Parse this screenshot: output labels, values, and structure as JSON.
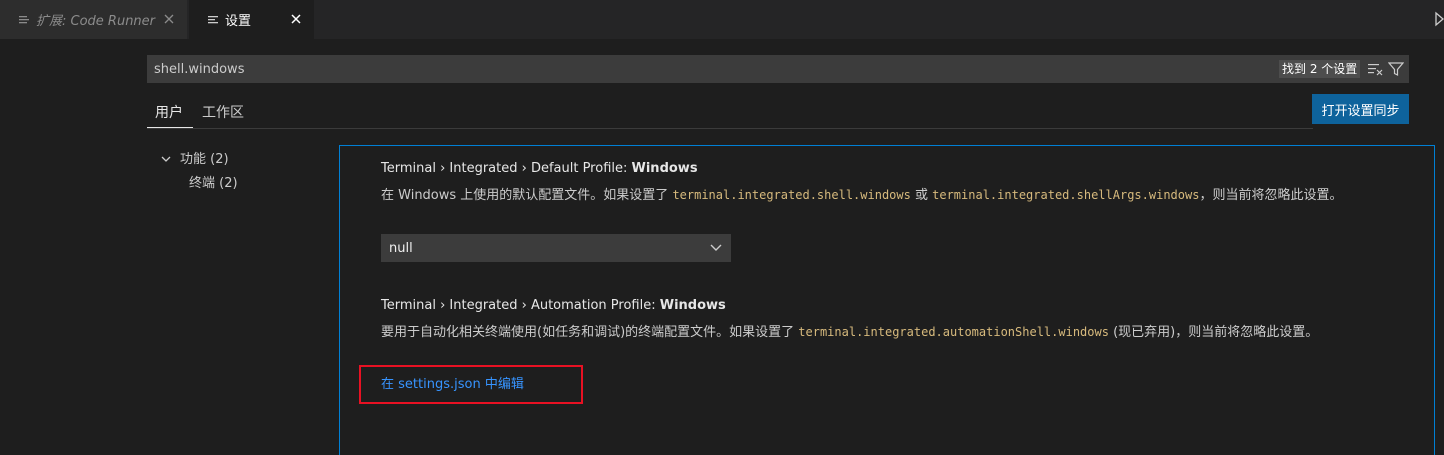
{
  "tabs": [
    {
      "label": "扩展: Code Runner",
      "icon": "preview-icon",
      "active": false
    },
    {
      "label": "设置",
      "icon": "settings-file-icon",
      "active": true
    }
  ],
  "search": {
    "value": "shell.windows",
    "result_count": "找到 2 个设置"
  },
  "scope_tabs": [
    "用户",
    "工作区"
  ],
  "sync_button_label": "打开设置同步",
  "toc": {
    "features": "功能 (2)",
    "terminal": "终端 (2)"
  },
  "settings": [
    {
      "category": "Terminal › Integrated › Default Profile: ",
      "name": "Windows",
      "desc_parts": [
        "在 Windows 上使用的默认配置文件。如果设置了 ",
        "terminal.integrated.shell.windows",
        " 或 ",
        "terminal.integrated.shellArgs.windows",
        "，则当前将忽略此设置。"
      ],
      "value": "null"
    },
    {
      "category": "Terminal › Integrated › Automation Profile: ",
      "name": "Windows",
      "desc_parts": [
        "要用于自动化相关终端使用(如任务和调试)的终端配置文件。如果设置了 ",
        "terminal.integrated.automationShell.windows",
        " (现已弃用)，则当前将忽略此设置。"
      ],
      "link": "在 settings.json 中编辑"
    }
  ],
  "colors": {
    "accent_border": "#007fd4",
    "link": "#3794ff",
    "button": "#0e639c",
    "annotation_box": "#e81123"
  }
}
